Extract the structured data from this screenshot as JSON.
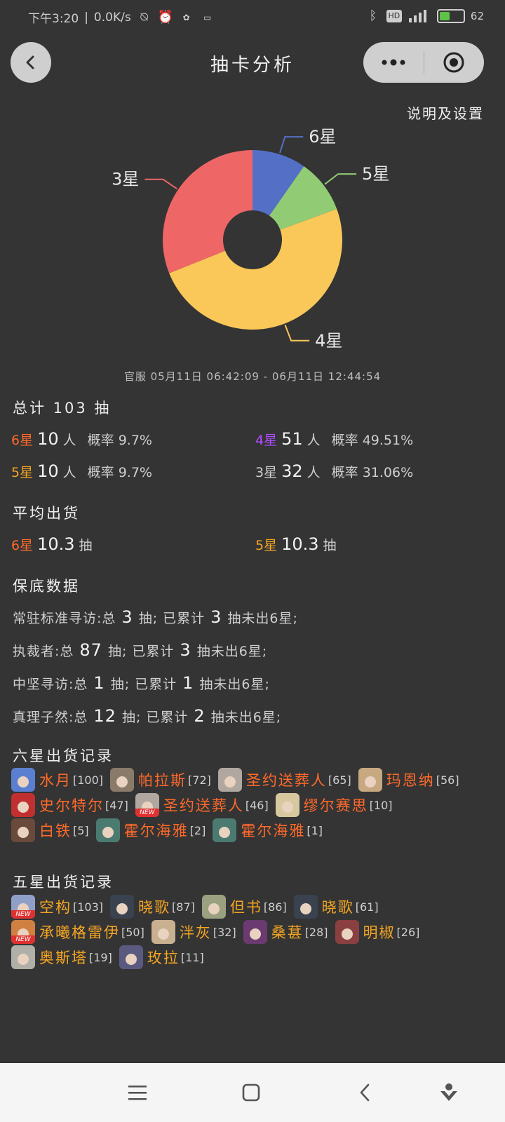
{
  "status_bar": {
    "time": "下午3:20",
    "net_speed": "0.0K/s",
    "battery": "62",
    "icons": [
      "mute-icon",
      "alarm-icon",
      "app-icon",
      "chat-icon",
      "bluetooth-icon",
      "hd-icon",
      "signal-icon",
      "battery-icon"
    ]
  },
  "nav": {
    "title": "抽卡分析",
    "settings_link": "说明及设置"
  },
  "chart_data": {
    "type": "pie",
    "categories": [
      "6星",
      "5星",
      "4星",
      "3星"
    ],
    "values": [
      10,
      10,
      51,
      32
    ],
    "colors": [
      "#5470c6",
      "#91cc75",
      "#fac858",
      "#ee6666"
    ],
    "donut": true
  },
  "range_text": "官服  05月11日 06:42:09  -  06月11日 12:44:54",
  "summary": {
    "total_label": "总计 103 抽",
    "rows": [
      {
        "star": "6星",
        "count": "10",
        "unit": "人",
        "rate": "概率 9.7%"
      },
      {
        "star": "4星",
        "count": "51",
        "unit": "人",
        "rate": "概率 49.51%"
      },
      {
        "star": "5星",
        "count": "10",
        "unit": "人",
        "rate": "概率 9.7%"
      },
      {
        "star": "3星",
        "count": "32",
        "unit": "人",
        "rate": "概率 31.06%"
      }
    ]
  },
  "average": {
    "title": "平均出货",
    "six": {
      "star": "6星",
      "value": "10.3",
      "unit": "抽"
    },
    "five": {
      "star": "5星",
      "value": "10.3",
      "unit": "抽"
    }
  },
  "pity": {
    "title": "保底数据",
    "rows": [
      {
        "pool": "常驻标准寻访:总",
        "total": "3",
        "mid": "抽;  已累计",
        "acc": "3",
        "tail": "抽未出6星;"
      },
      {
        "pool": "执裁者:总",
        "total": "87",
        "mid": "抽;  已累计",
        "acc": "3",
        "tail": "抽未出6星;"
      },
      {
        "pool": "中坚寻访:总",
        "total": "1",
        "mid": "抽;  已累计",
        "acc": "1",
        "tail": "抽未出6星;"
      },
      {
        "pool": "真理子然:总",
        "total": "12",
        "mid": "抽;  已累计",
        "acc": "2",
        "tail": "抽未出6星;"
      }
    ]
  },
  "six_records": {
    "title": "六星出货记录",
    "lines": [
      [
        {
          "name": "水月",
          "count": "[100]",
          "avatar": "#5b7fd0",
          "new": false
        },
        {
          "name": "帕拉斯",
          "count": "[72]",
          "avatar": "#8a7a6a",
          "new": false
        },
        {
          "name": "圣约送葬人",
          "count": "[65]",
          "avatar": "#b0a8a0",
          "new": false
        },
        {
          "name": "玛恩纳",
          "count": "[56]",
          "avatar": "#c7a880",
          "new": false
        }
      ],
      [
        {
          "name": "史尔特尔",
          "count": "[47]",
          "avatar": "#c03030",
          "new": false
        },
        {
          "name": "圣约送葬人",
          "count": "[46]",
          "avatar": "#b0a8a0",
          "new": true
        },
        {
          "name": "缪尔赛思",
          "count": "[10]",
          "avatar": "#d8c8a0",
          "new": false
        }
      ],
      [
        {
          "name": "白铁",
          "count": "[5]",
          "avatar": "#6a4a3a",
          "new": false
        },
        {
          "name": "霍尔海雅",
          "count": "[2]",
          "avatar": "#4a7a70",
          "new": false
        },
        {
          "name": "霍尔海雅",
          "count": "[1]",
          "avatar": "#4a7a70",
          "new": false
        }
      ]
    ],
    "new_label": "NEW"
  },
  "five_records": {
    "title": "五星出货记录",
    "lines": [
      [
        {
          "name": "空构",
          "count": "[103]",
          "avatar": "#8fa0c8",
          "new": true
        },
        {
          "name": "晓歌",
          "count": "[87]",
          "avatar": "#3a4250",
          "new": false
        },
        {
          "name": "但书",
          "count": "[86]",
          "avatar": "#9aa080",
          "new": false
        },
        {
          "name": "晓歌",
          "count": "[61]",
          "avatar": "#3a4250",
          "new": false
        }
      ],
      [
        {
          "name": "承曦格雷伊",
          "count": "[50]",
          "avatar": "#d08040",
          "new": true
        },
        {
          "name": "泮灰",
          "count": "[32]",
          "avatar": "#c8b090",
          "new": false
        },
        {
          "name": "桑葚",
          "count": "[28]",
          "avatar": "#6a3a70",
          "new": false
        },
        {
          "name": "明椒",
          "count": "[26]",
          "avatar": "#8a4040",
          "new": false
        }
      ],
      [
        {
          "name": "奥斯塔",
          "count": "[19]",
          "avatar": "#b0b0a8",
          "new": false
        },
        {
          "name": "玫拉",
          "count": "[11]",
          "avatar": "#5a5a80",
          "new": false
        }
      ]
    ],
    "new_label": "NEW"
  }
}
